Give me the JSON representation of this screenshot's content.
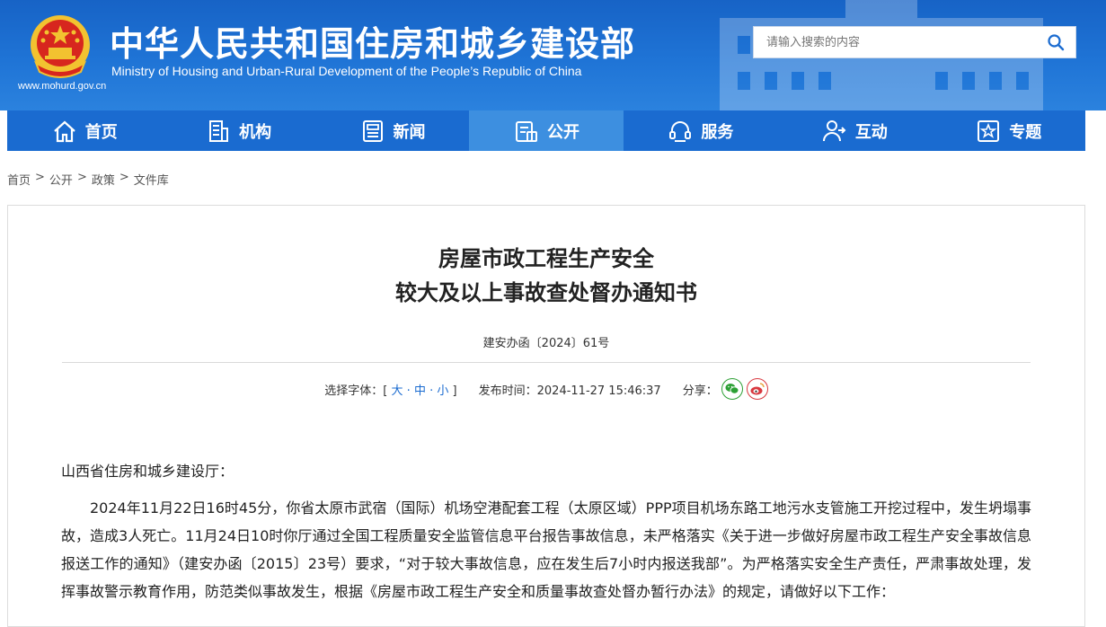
{
  "header": {
    "site_title": "中华人民共和国住房和城乡建设部",
    "site_subtitle": "Ministry of Housing and Urban-Rural Development of the People’s Republic of China",
    "site_url": "www.mohurd.gov.cn",
    "search_placeholder": "请输入搜索的内容"
  },
  "nav": [
    {
      "label": "首页",
      "icon": "home-icon"
    },
    {
      "label": "机构",
      "icon": "building-icon"
    },
    {
      "label": "新闻",
      "icon": "news-icon"
    },
    {
      "label": "公开",
      "icon": "disclosure-icon",
      "active": true
    },
    {
      "label": "服务",
      "icon": "service-icon"
    },
    {
      "label": "互动",
      "icon": "interaction-icon"
    },
    {
      "label": "专题",
      "icon": "star-topic-icon"
    }
  ],
  "breadcrumb": [
    "首页",
    "公开",
    "政策",
    "文件库"
  ],
  "breadcrumb_sep": ">",
  "article": {
    "title_line1": "房屋市政工程生产安全",
    "title_line2": "较大及以上事故查处督办通知书",
    "doc_number": "建安办函〔2024〕61号",
    "font_label": "选择字体：[",
    "font_large": "大",
    "font_medium": "中",
    "font_small": "小",
    "font_sep": "·",
    "font_close": "]",
    "publish_label": "发布时间：",
    "publish_time": "2024-11-27 15:46:37",
    "share_label": "分享：",
    "salutation": "山西省住房和城乡建设厅：",
    "paragraph": "2024年11月22日16时45分，你省太原市武宿（国际）机场空港配套工程（太原区域）PPP项目机场东路工地污水支管施工开挖过程中，发生坍塌事故，造成3人死亡。11月24日10时你厅通过全国工程质量安全监管信息平台报告事故信息，未严格落实《关于进一步做好房屋市政工程生产安全事故信息报送工作的通知》（建安办函〔2015〕23号）要求，“对于较大事故信息，应在发生后7小时内报送我部”。为严格落实安全生产责任，严肃事故处理，发挥事故警示教育作用，防范类似事故发生，根据《房屋市政工程生产安全和质量事故查处督办暂行办法》的规定，请做好以下工作："
  },
  "colors": {
    "header_blue": "#1763c6",
    "nav_blue": "#1a6bd0",
    "nav_active": "#3d8fe0",
    "link_blue": "#1a6bd0",
    "wechat_green": "#2da035",
    "weibo_red": "#d9383f"
  }
}
